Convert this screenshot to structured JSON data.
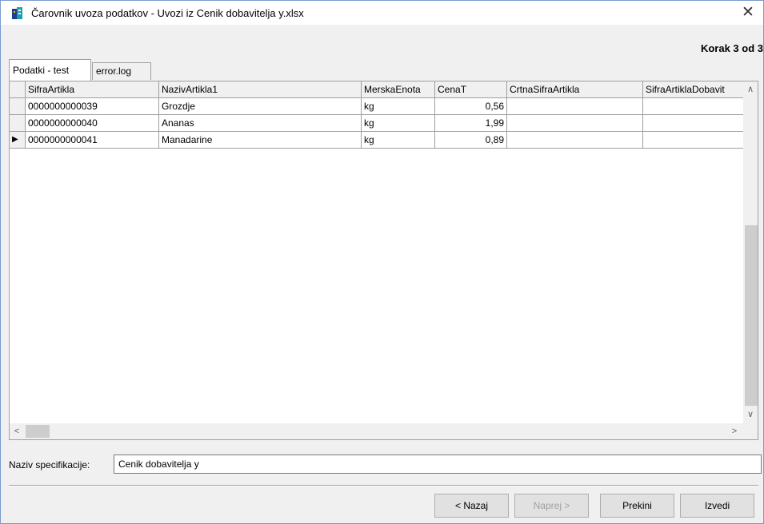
{
  "window": {
    "title": "Čarovnik uvoza podatkov - Uvozi iz Cenik dobavitelja y.xlsx",
    "close_glyph": "✕",
    "step": "Korak 3 od 3"
  },
  "tabs": [
    {
      "label": "Podatki - test",
      "active": true
    },
    {
      "label": "error.log",
      "active": false
    }
  ],
  "grid": {
    "columns": [
      "SifraArtikla",
      "NazivArtikla1",
      "MerskaEnota",
      "CenaT",
      "CrtnaSifraArtikla",
      "SifraArtiklaDobavit"
    ],
    "rows": [
      [
        "0000000000039",
        "Grozdje",
        "kg",
        "0,56",
        "",
        ""
      ],
      [
        "0000000000040",
        "Ananas",
        "kg",
        "1,99",
        "",
        ""
      ],
      [
        "0000000000041",
        "Manadarine",
        "kg",
        "0,89",
        "",
        ""
      ]
    ],
    "current_row_marker": "▶",
    "scroll_up": "∧",
    "scroll_down": "∨",
    "scroll_left": "<",
    "scroll_right": ">"
  },
  "spec": {
    "label": "Naziv specifikacije:",
    "value": "Cenik dobavitelja y"
  },
  "buttons": {
    "back": "< Nazaj",
    "next": "Naprej >",
    "cancel": "Prekini",
    "execute": "Izvedi"
  },
  "colors": {
    "accent": "#7a9ad1",
    "icon_teal": "#1a9fb0",
    "icon_blue": "#1f3c8f"
  }
}
